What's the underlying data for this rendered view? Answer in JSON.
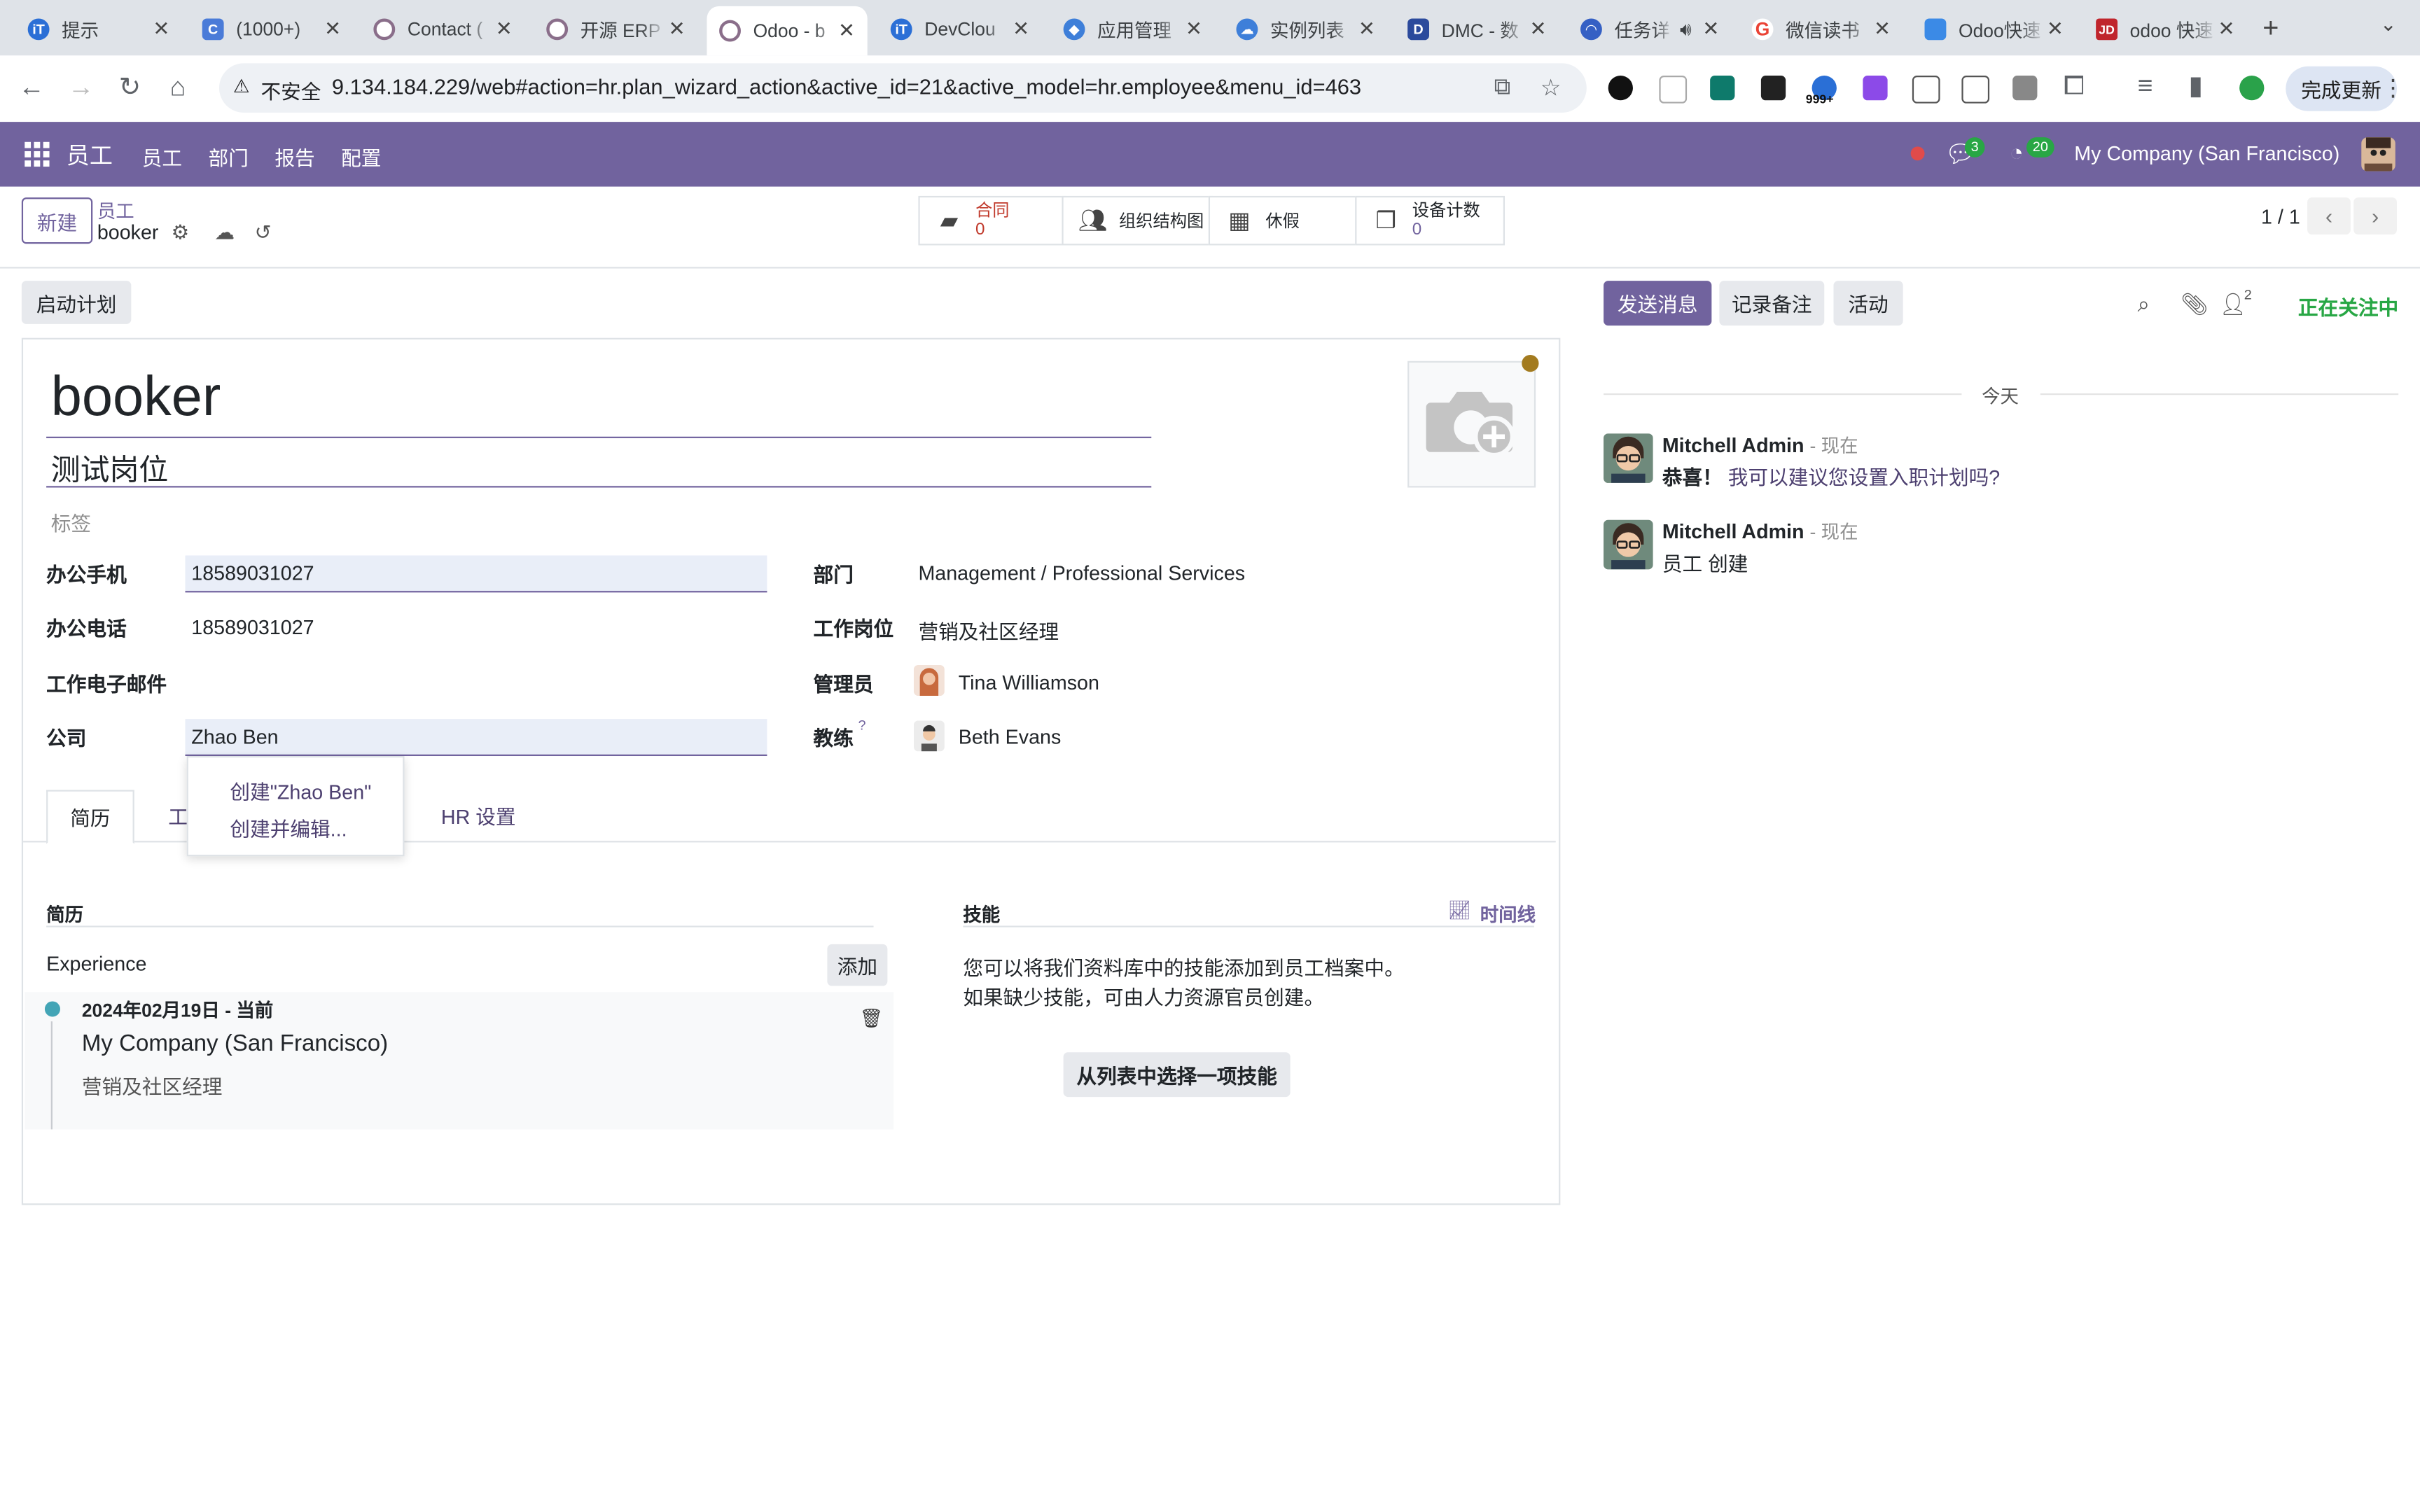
{
  "browser": {
    "tabs": [
      {
        "title": "提示",
        "color": "#2b6fd6",
        "glyph": "iT"
      },
      {
        "title": "(1000+) ",
        "color": "#4a7bd8",
        "glyph": "C"
      },
      {
        "title": "Contact (",
        "color": "#8a6e8a",
        "glyph": "O"
      },
      {
        "title": "开源 ERP",
        "color": "#8a6e8a",
        "glyph": "O"
      },
      {
        "title": "Odoo - b",
        "color": "#8a6e8a",
        "glyph": "O"
      },
      {
        "title": "DevClou",
        "color": "#2b6fd6",
        "glyph": "iT"
      },
      {
        "title": "应用管理",
        "color": "#3e7fd9",
        "glyph": "◆"
      },
      {
        "title": "实例列表",
        "color": "#3e7fd9",
        "glyph": "☁"
      },
      {
        "title": "DMC - 数",
        "color": "#2b4a9c",
        "glyph": "D"
      },
      {
        "title": "任务详",
        "color": "#3560c4",
        "glyph": "◠"
      },
      {
        "title": "微信读书",
        "color": "#ea4335",
        "glyph": "G"
      },
      {
        "title": "Odoo快速",
        "color": "#3b8ae6",
        "glyph": "▀"
      },
      {
        "title": "odoo 快速",
        "color": "#c0252c",
        "glyph": "JD"
      }
    ],
    "active_tab": 4,
    "security_label": "不安全",
    "url": "9.134.184.229/web#action=hr.plan_wizard_action&active_id=21&active_model=hr.employee&menu_id=463",
    "update_label": "完成更新",
    "ext_badge": "999+"
  },
  "navbar": {
    "brand": "员工",
    "menu": [
      "员工",
      "部门",
      "报告",
      "配置"
    ],
    "messages_count": "3",
    "activities_count": "20",
    "company": "My Company (San Francisco)"
  },
  "control_panel": {
    "new_label": "新建",
    "breadcrumb_parent": "员工",
    "breadcrumb_current": "booker",
    "smart_buttons": [
      {
        "label": "合同",
        "count": "0",
        "icon": "book-icon",
        "warn": true
      },
      {
        "label": "组织结构图",
        "count": "",
        "icon": "users-icon",
        "warn": false
      },
      {
        "label": "休假",
        "count": "",
        "icon": "calendar-icon",
        "warn": false
      },
      {
        "label": "设备计数",
        "count": "0",
        "icon": "cubes-icon",
        "warn": false
      }
    ],
    "pager": "1 / 1"
  },
  "form": {
    "action_button": "启动计划",
    "employee_name": "booker",
    "job_title": "测试岗位",
    "tags_placeholder": "标签",
    "left_fields": [
      {
        "label": "办公手机",
        "value": "18589031027"
      },
      {
        "label": "办公电话",
        "value": "18589031027"
      },
      {
        "label": "工作电子邮件",
        "value": ""
      },
      {
        "label": "公司",
        "value": "Zhao Ben"
      }
    ],
    "right_fields": [
      {
        "label": "部门",
        "value": "Management / Professional Services"
      },
      {
        "label": "工作岗位",
        "value": "营销及社区经理"
      },
      {
        "label": "管理员",
        "value": "Tina Williamson"
      },
      {
        "label": "教练",
        "value": "Beth Evans",
        "help": "?"
      }
    ],
    "autocomplete": [
      "创建\"Zhao Ben\"",
      "创建并编辑..."
    ],
    "tabs": [
      "简历",
      "工作",
      "HR 设置"
    ],
    "active_tab": "简历",
    "resume": {
      "section_title": "简历",
      "group": "Experience",
      "add_label": "添加",
      "entry": {
        "dates": "2024年02月19日 - 当前",
        "company": "My Company (San Francisco)",
        "role": "营销及社区经理"
      }
    },
    "skills": {
      "section_title": "技能",
      "timeline_label": "时间线",
      "help_line1": "您可以将我们资料库中的技能添加到员工档案中。",
      "help_line2": "如果缺少技能，可由人力资源官员创建。",
      "pick_label": "从列表中选择一项技能"
    }
  },
  "chatter": {
    "send_label": "发送消息",
    "note_label": "记录备注",
    "activity_label": "活动",
    "followers_count": "2",
    "following_label": "正在关注中",
    "date_separator": "今天",
    "messages": [
      {
        "author": "Mitchell Admin",
        "when": "- 现在",
        "text_bold": "恭喜！",
        "text": " 我可以建议您设置入职计划吗?"
      },
      {
        "author": "Mitchell Admin",
        "when": "- 现在",
        "text_bold": "",
        "text": "员工 创建"
      }
    ]
  }
}
